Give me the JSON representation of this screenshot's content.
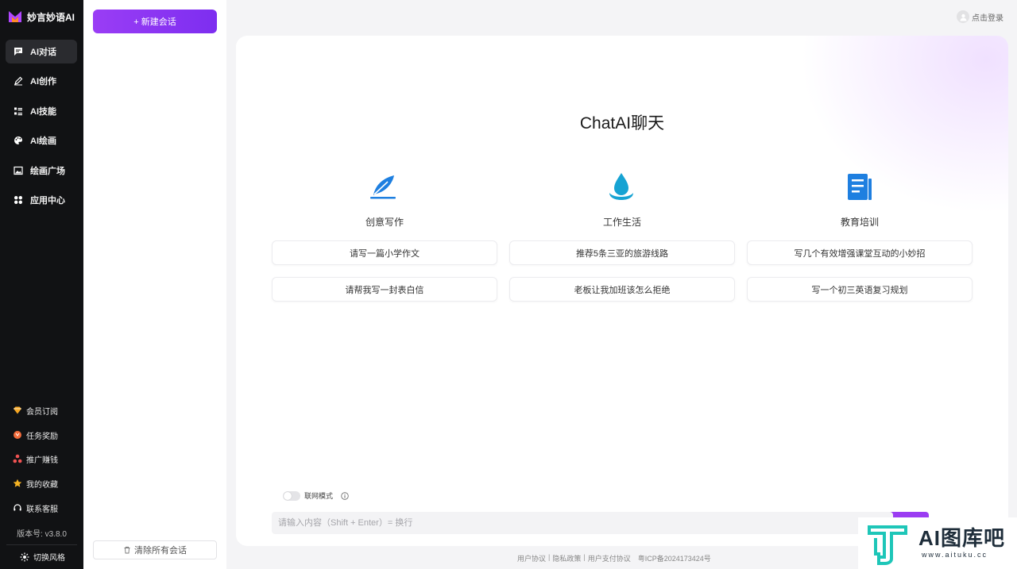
{
  "brand": {
    "name": "妙言妙语AI"
  },
  "nav": {
    "items": [
      {
        "label": "AI对话",
        "icon": "chat-icon",
        "active": true
      },
      {
        "label": "AI创作",
        "icon": "pen-icon"
      },
      {
        "label": "AI技能",
        "icon": "list-icon"
      },
      {
        "label": "AI绘画",
        "icon": "palette-icon"
      },
      {
        "label": "绘画广场",
        "icon": "image-icon"
      },
      {
        "label": "应用中心",
        "icon": "apps-icon"
      }
    ],
    "bottom": [
      {
        "label": "会员订阅",
        "icon": "diamond-icon"
      },
      {
        "label": "任务奖励",
        "icon": "reward-icon"
      },
      {
        "label": "推广赚钱",
        "icon": "promote-icon"
      },
      {
        "label": "我的收藏",
        "icon": "star-icon"
      },
      {
        "label": "联系客服",
        "icon": "headset-icon"
      }
    ],
    "version": "版本号: v3.8.0",
    "switch_style": "切换风格"
  },
  "sessions": {
    "new_chat": "+ 新建会话",
    "clear_all": "清除所有会话"
  },
  "header": {
    "login": "点击登录"
  },
  "main": {
    "title": "ChatAI聊天",
    "columns": [
      {
        "title": "创意写作",
        "icon": "feather-icon",
        "prompts": [
          "请写一篇小学作文",
          "请帮我写一封表白信"
        ]
      },
      {
        "title": "工作生活",
        "icon": "water-drop-icon",
        "prompts": [
          "推荐5条三亚的旅游线路",
          "老板让我加班该怎么拒绝"
        ]
      },
      {
        "title": "教育培训",
        "icon": "document-icon",
        "prompts": [
          "写几个有效增强课堂互动的小妙招",
          "写一个初三英语复习规划"
        ]
      }
    ],
    "web_mode": "联网模式",
    "input_placeholder": "请输入内容（Shift + Enter）= 换行"
  },
  "footer": {
    "links": [
      "用户协议",
      "隐私政策",
      "用户支付协议"
    ],
    "separator": "|",
    "icp": "粤ICP备2024173424号"
  },
  "watermark": {
    "text": "AI图库吧",
    "url": "www.aituku.cc"
  },
  "colors": {
    "accent": "#9b3cf2",
    "nav_bg": "#111214",
    "icon_blue": "#1e7fe0"
  }
}
